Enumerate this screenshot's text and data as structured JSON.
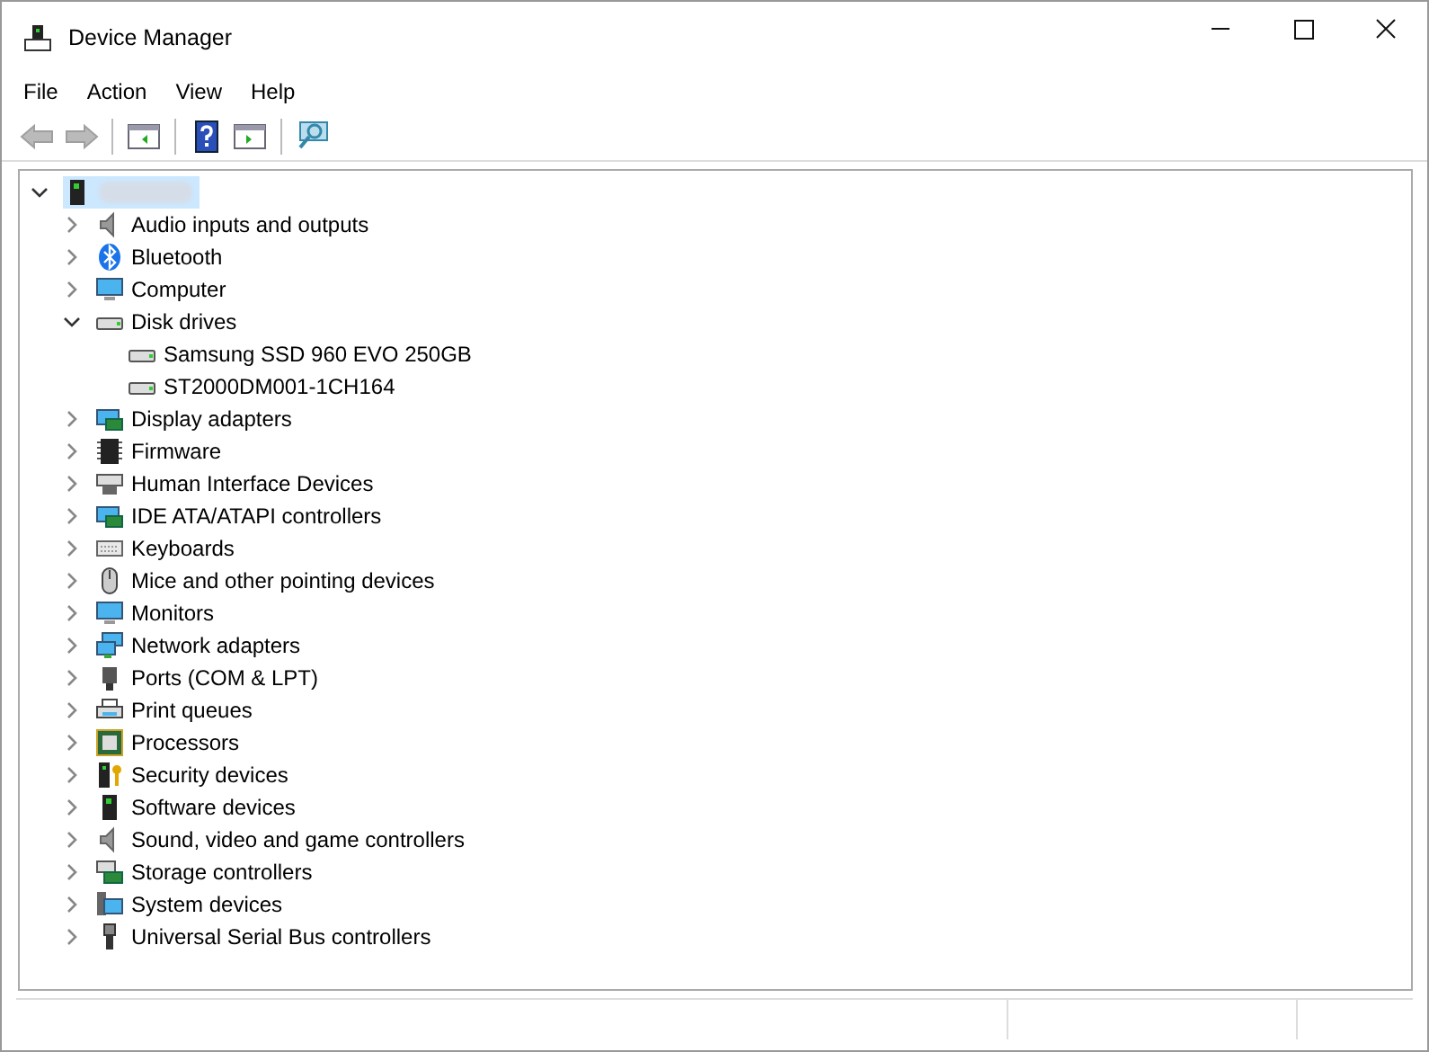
{
  "window": {
    "title": "Device Manager"
  },
  "menu": [
    "File",
    "Action",
    "View",
    "Help"
  ],
  "toolbar": [
    {
      "kind": "back",
      "disabled": true
    },
    {
      "kind": "forward",
      "disabled": true
    },
    {
      "kind": "sep"
    },
    {
      "kind": "console",
      "disabled": false
    },
    {
      "kind": "sep"
    },
    {
      "kind": "help",
      "disabled": false
    },
    {
      "kind": "pane",
      "disabled": false
    },
    {
      "kind": "sep"
    },
    {
      "kind": "scan",
      "disabled": false
    }
  ],
  "tree": {
    "root": {
      "kind": "computer-root",
      "expanded": true,
      "selected": true,
      "children": [
        {
          "label": "Audio inputs and outputs",
          "kind": "speaker",
          "expanded": false
        },
        {
          "label": "Bluetooth",
          "kind": "bluetooth",
          "expanded": false
        },
        {
          "label": "Computer",
          "kind": "monitor",
          "expanded": false
        },
        {
          "label": "Disk drives",
          "kind": "disk",
          "expanded": true,
          "children": [
            {
              "label": "Samsung SSD 960 EVO 250GB",
              "kind": "disk"
            },
            {
              "label": "ST2000DM001-1CH164",
              "kind": "disk"
            }
          ]
        },
        {
          "label": "Display adapters",
          "kind": "card",
          "expanded": false
        },
        {
          "label": "Firmware",
          "kind": "chip",
          "expanded": false
        },
        {
          "label": "Human Interface Devices",
          "kind": "hid",
          "expanded": false
        },
        {
          "label": "IDE ATA/ATAPI controllers",
          "kind": "card",
          "expanded": false
        },
        {
          "label": "Keyboards",
          "kind": "keyboard",
          "expanded": false
        },
        {
          "label": "Mice and other pointing devices",
          "kind": "mouse",
          "expanded": false
        },
        {
          "label": "Monitors",
          "kind": "monitor",
          "expanded": false
        },
        {
          "label": "Network adapters",
          "kind": "network",
          "expanded": false
        },
        {
          "label": "Ports (COM & LPT)",
          "kind": "port",
          "expanded": false
        },
        {
          "label": "Print queues",
          "kind": "printer",
          "expanded": false
        },
        {
          "label": "Processors",
          "kind": "cpu",
          "expanded": false
        },
        {
          "label": "Security devices",
          "kind": "security",
          "expanded": false
        },
        {
          "label": "Software devices",
          "kind": "tower",
          "expanded": false
        },
        {
          "label": "Sound, video and game controllers",
          "kind": "speaker",
          "expanded": false
        },
        {
          "label": "Storage controllers",
          "kind": "storage",
          "expanded": false
        },
        {
          "label": "System devices",
          "kind": "system",
          "expanded": false
        },
        {
          "label": "Universal Serial Bus controllers",
          "kind": "usb",
          "expanded": false
        }
      ]
    }
  }
}
